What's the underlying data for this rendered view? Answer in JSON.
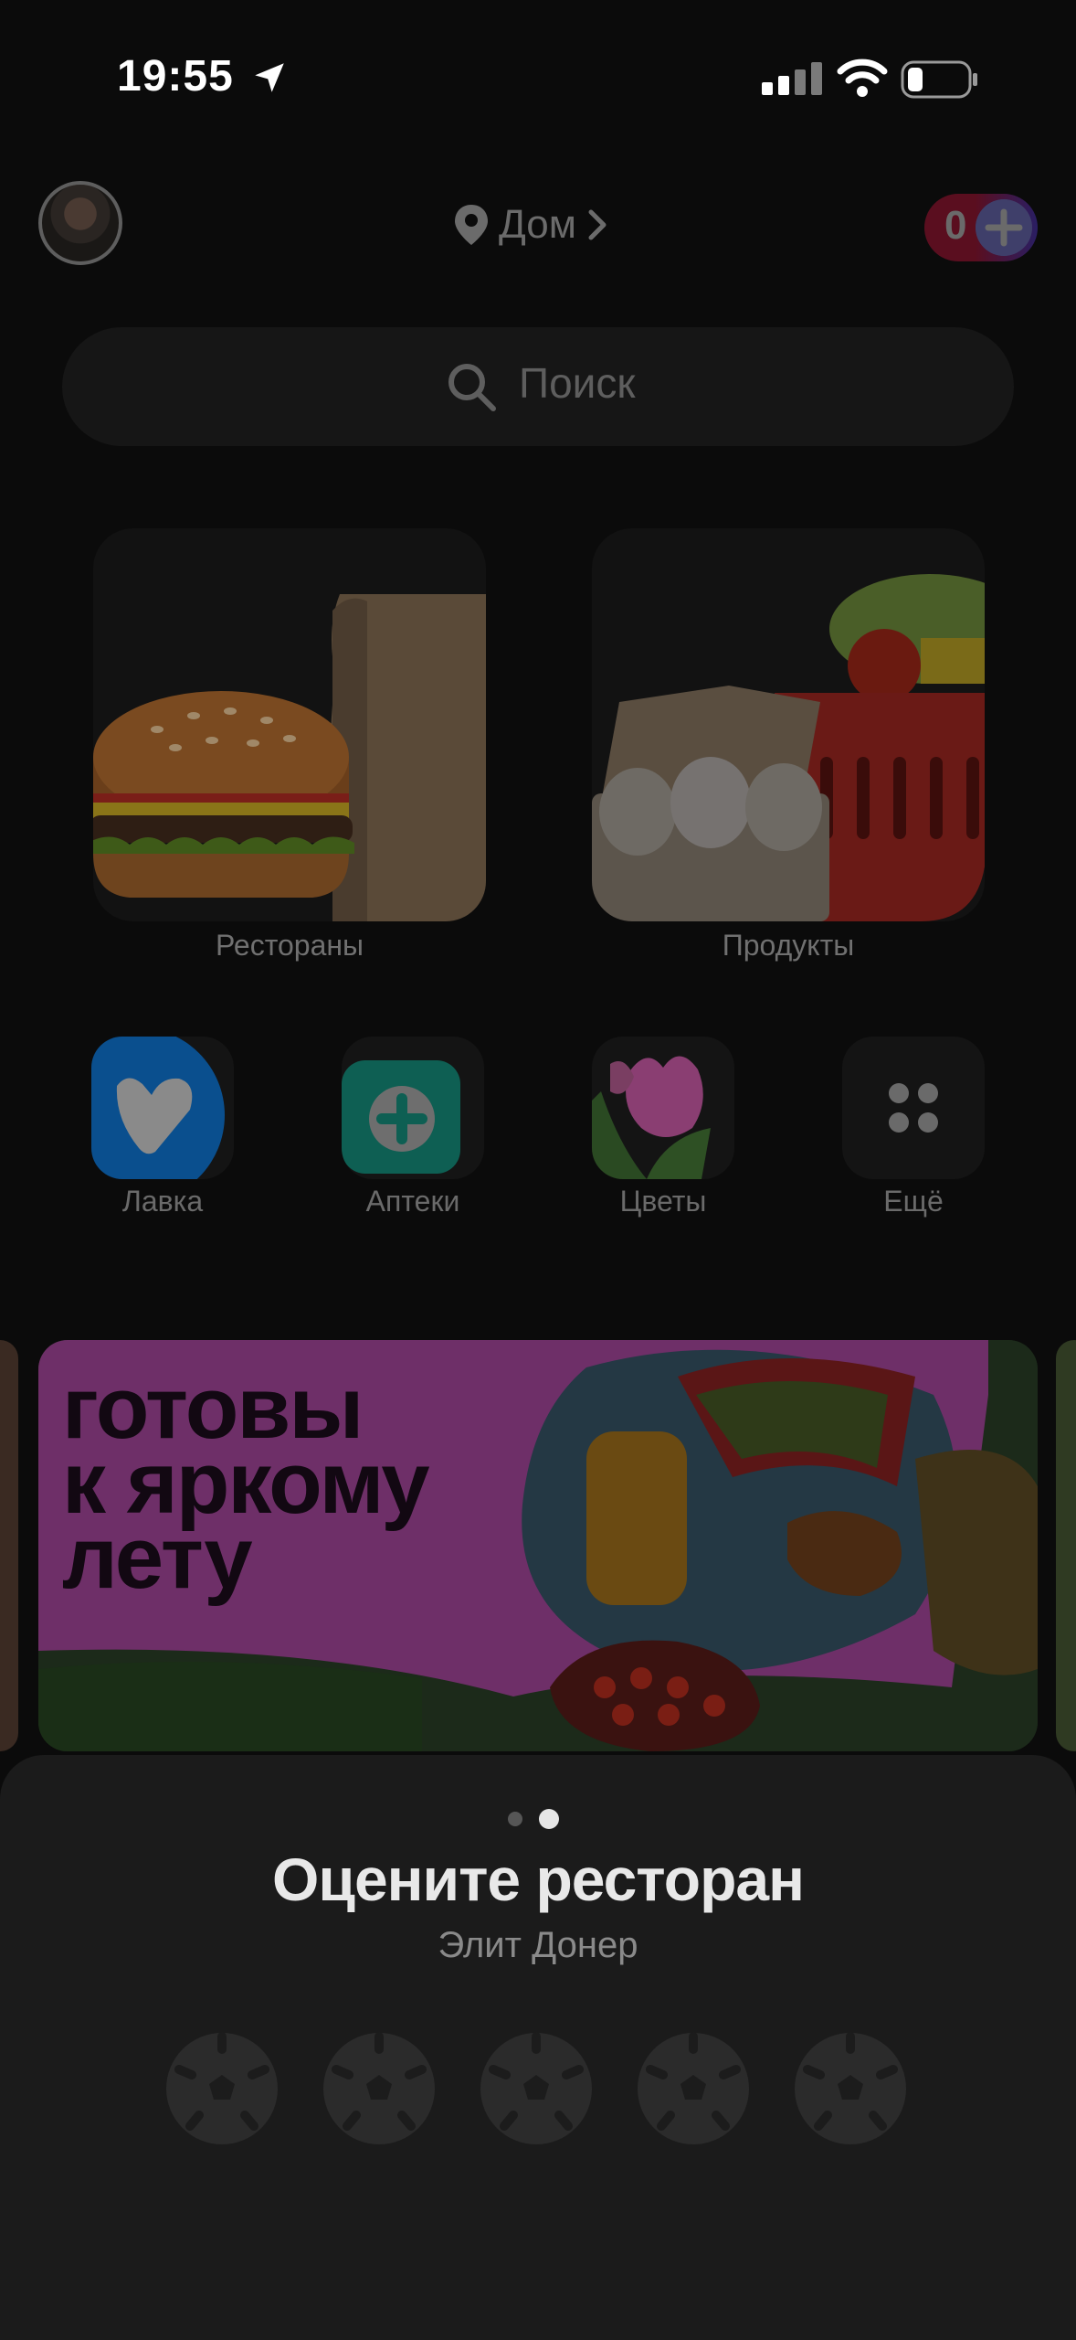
{
  "status_bar": {
    "time": "19:55"
  },
  "header": {
    "address": "Дом",
    "points": "0"
  },
  "search": {
    "placeholder": "Поиск"
  },
  "categories": [
    {
      "label": "Рестораны",
      "icon": "burger-icon"
    },
    {
      "label": "Продукты",
      "icon": "grocery-basket-icon"
    }
  ],
  "services": [
    {
      "label": "Лавка",
      "icon": "lavka-heart-icon",
      "color": "#0a63b4"
    },
    {
      "label": "Аптеки",
      "icon": "pharmacy-cross-icon",
      "color": "#0f7d6c"
    },
    {
      "label": "Цветы",
      "icon": "tulip-icon",
      "color": "#b46aa0"
    },
    {
      "label": "Ещё",
      "icon": "more-grid-icon",
      "color": "#1a1a1a"
    }
  ],
  "promo": {
    "title": "готовы\nк яркому\nлету",
    "accent": "#7a3a78"
  },
  "rating_sheet": {
    "title": "Оцените ресторан",
    "restaurant": "Элит Донер",
    "pager": {
      "count": 2,
      "active": 2
    },
    "rating": {
      "max": 5,
      "value": 0,
      "icon": "soccer-ball-icon"
    }
  }
}
